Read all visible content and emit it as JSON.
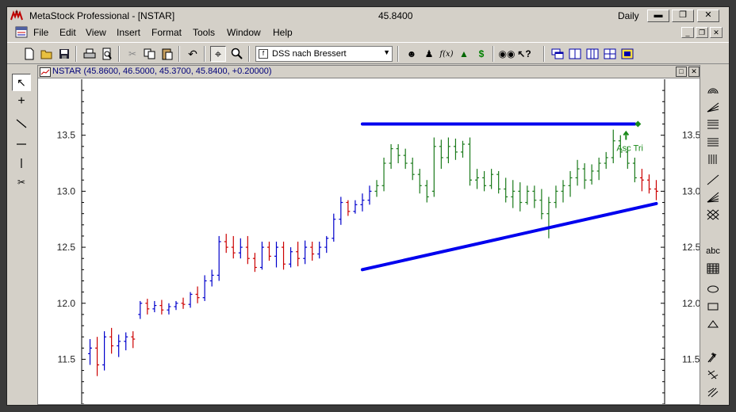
{
  "window": {
    "title": "MetaStock Professional - [NSTAR]",
    "price": "45.8400",
    "period": "Daily",
    "controls": [
      "minimize",
      "restore",
      "close"
    ]
  },
  "menu": {
    "items": [
      "File",
      "Edit",
      "View",
      "Insert",
      "Format",
      "Tools",
      "Window",
      "Help"
    ]
  },
  "toolbar": {
    "expert_combo_value": "DSS nach Bressert",
    "fx_label": "f(x)",
    "dollar_label": "$"
  },
  "chart_window": {
    "caption": "NSTAR (45.8600, 46.5000, 45.3700, 45.8400, +0.20000)"
  },
  "icons": {
    "left_tools": [
      "pointer-icon",
      "crosshair-icon",
      "diagonal-line-icon",
      "horizontal-line-icon",
      "vertical-line-icon",
      "scissors-icon"
    ],
    "right_tools": [
      "arc-icon",
      "fan-icon",
      "fibonacci-retracement-icon",
      "horizontal-lines-icon",
      "vertical-lines-icon",
      "trendline-icon",
      "speed-lines-icon",
      "gann-grid-icon",
      "text-icon",
      "grid-icon",
      "ellipse-icon",
      "rectangle-icon",
      "triangle-icon",
      "buy-arrow-icon",
      "sell-arrow-icon",
      "exit-arrow-icon"
    ]
  },
  "text_tool_label": "abc",
  "chart_data": {
    "type": "ohlc",
    "symbol": "NSTAR",
    "y_ticks": [
      "13.5",
      "13.0",
      "12.5",
      "12.0",
      "11.5"
    ],
    "y_tick_values": [
      13.5,
      13.0,
      12.5,
      12.0,
      11.5
    ],
    "ylim": [
      11.1,
      14.0
    ],
    "colors": {
      "up": "#0000cc",
      "down": "#cc0000",
      "pattern": "#1a7a1a",
      "trendline": "#0000ee",
      "annotation": "#1a8a1a"
    },
    "annotation": {
      "text": "Asc Tri",
      "bar": 75,
      "price": 13.6
    },
    "trendlines": [
      {
        "from": {
          "bar": 38,
          "price": 13.6
        },
        "to": {
          "bar": 76,
          "price": 13.6
        }
      },
      {
        "from": {
          "bar": 38,
          "price": 12.3
        },
        "to": {
          "bar": 79,
          "price": 12.89
        }
      }
    ],
    "pattern_range": [
      40,
      76
    ],
    "bars": [
      {
        "o": 11.55,
        "h": 11.68,
        "l": 11.45,
        "c": 11.6
      },
      {
        "o": 11.6,
        "h": 11.7,
        "l": 11.35,
        "c": 11.45
      },
      {
        "o": 11.45,
        "h": 11.75,
        "l": 11.4,
        "c": 11.7
      },
      {
        "o": 11.7,
        "h": 11.78,
        "l": 11.55,
        "c": 11.62
      },
      {
        "o": 11.62,
        "h": 11.72,
        "l": 11.52,
        "c": 11.66
      },
      {
        "o": 11.66,
        "h": 11.74,
        "l": 11.58,
        "c": 11.7
      },
      {
        "o": 11.7,
        "h": 11.75,
        "l": 11.6,
        "c": 11.68
      },
      {
        "o": 11.9,
        "h": 12.02,
        "l": 11.86,
        "c": 12.0
      },
      {
        "o": 12.0,
        "h": 12.04,
        "l": 11.9,
        "c": 11.95
      },
      {
        "o": 11.95,
        "h": 12.02,
        "l": 11.92,
        "c": 11.98
      },
      {
        "o": 11.98,
        "h": 12.03,
        "l": 11.9,
        "c": 11.94
      },
      {
        "o": 11.94,
        "h": 12.0,
        "l": 11.9,
        "c": 11.97
      },
      {
        "o": 11.97,
        "h": 12.02,
        "l": 11.94,
        "c": 12.0
      },
      {
        "o": 12.0,
        "h": 12.05,
        "l": 11.95,
        "c": 11.99
      },
      {
        "o": 11.99,
        "h": 12.1,
        "l": 11.96,
        "c": 12.08
      },
      {
        "o": 12.08,
        "h": 12.15,
        "l": 12.0,
        "c": 12.05
      },
      {
        "o": 12.05,
        "h": 12.25,
        "l": 12.02,
        "c": 12.2
      },
      {
        "o": 12.2,
        "h": 12.3,
        "l": 12.15,
        "c": 12.25
      },
      {
        "o": 12.25,
        "h": 12.6,
        "l": 12.2,
        "c": 12.55
      },
      {
        "o": 12.55,
        "h": 12.62,
        "l": 12.45,
        "c": 12.5
      },
      {
        "o": 12.5,
        "h": 12.6,
        "l": 12.4,
        "c": 12.45
      },
      {
        "o": 12.45,
        "h": 12.58,
        "l": 12.4,
        "c": 12.5
      },
      {
        "o": 12.5,
        "h": 12.6,
        "l": 12.35,
        "c": 12.4
      },
      {
        "o": 12.4,
        "h": 12.45,
        "l": 12.28,
        "c": 12.32
      },
      {
        "o": 12.32,
        "h": 12.55,
        "l": 12.3,
        "c": 12.5
      },
      {
        "o": 12.5,
        "h": 12.55,
        "l": 12.38,
        "c": 12.42
      },
      {
        "o": 12.42,
        "h": 12.55,
        "l": 12.32,
        "c": 12.5
      },
      {
        "o": 12.5,
        "h": 12.55,
        "l": 12.3,
        "c": 12.35
      },
      {
        "o": 12.35,
        "h": 12.5,
        "l": 12.32,
        "c": 12.46
      },
      {
        "o": 12.46,
        "h": 12.55,
        "l": 12.33,
        "c": 12.4
      },
      {
        "o": 12.4,
        "h": 12.56,
        "l": 12.35,
        "c": 12.5
      },
      {
        "o": 12.5,
        "h": 12.55,
        "l": 12.38,
        "c": 12.44
      },
      {
        "o": 12.44,
        "h": 12.55,
        "l": 12.4,
        "c": 12.5
      },
      {
        "o": 12.5,
        "h": 12.6,
        "l": 12.45,
        "c": 12.58
      },
      {
        "o": 12.58,
        "h": 12.8,
        "l": 12.55,
        "c": 12.75
      },
      {
        "o": 12.75,
        "h": 12.95,
        "l": 12.7,
        "c": 12.9
      },
      {
        "o": 12.9,
        "h": 12.92,
        "l": 12.78,
        "c": 12.82
      },
      {
        "o": 12.82,
        "h": 12.92,
        "l": 12.8,
        "c": 12.88
      },
      {
        "o": 12.88,
        "h": 12.98,
        "l": 12.82,
        "c": 12.92
      },
      {
        "o": 12.92,
        "h": 13.05,
        "l": 12.88,
        "c": 13.0
      },
      {
        "o": 13.0,
        "h": 13.1,
        "l": 12.95,
        "c": 13.05
      },
      {
        "o": 13.05,
        "h": 13.3,
        "l": 13.0,
        "c": 13.25
      },
      {
        "o": 13.25,
        "h": 13.42,
        "l": 13.2,
        "c": 13.38
      },
      {
        "o": 13.38,
        "h": 13.42,
        "l": 13.25,
        "c": 13.32
      },
      {
        "o": 13.32,
        "h": 13.38,
        "l": 13.2,
        "c": 13.25
      },
      {
        "o": 13.25,
        "h": 13.3,
        "l": 13.1,
        "c": 13.15
      },
      {
        "o": 13.15,
        "h": 13.2,
        "l": 12.98,
        "c": 13.05
      },
      {
        "o": 13.05,
        "h": 13.1,
        "l": 12.9,
        "c": 12.95
      },
      {
        "o": 13.0,
        "h": 13.48,
        "l": 12.95,
        "c": 13.4
      },
      {
        "o": 13.4,
        "h": 13.46,
        "l": 13.2,
        "c": 13.3
      },
      {
        "o": 13.3,
        "h": 13.48,
        "l": 13.25,
        "c": 13.4
      },
      {
        "o": 13.4,
        "h": 13.47,
        "l": 13.28,
        "c": 13.35
      },
      {
        "o": 13.35,
        "h": 13.45,
        "l": 13.3,
        "c": 13.42
      },
      {
        "o": 13.42,
        "h": 13.48,
        "l": 13.05,
        "c": 13.1
      },
      {
        "o": 13.1,
        "h": 13.2,
        "l": 13.02,
        "c": 13.12
      },
      {
        "o": 13.12,
        "h": 13.18,
        "l": 13.0,
        "c": 13.05
      },
      {
        "o": 13.05,
        "h": 13.2,
        "l": 13.02,
        "c": 13.15
      },
      {
        "o": 13.15,
        "h": 13.18,
        "l": 12.98,
        "c": 13.02
      },
      {
        "o": 13.02,
        "h": 13.12,
        "l": 12.9,
        "c": 12.95
      },
      {
        "o": 12.95,
        "h": 13.1,
        "l": 12.85,
        "c": 13.0
      },
      {
        "o": 13.0,
        "h": 13.08,
        "l": 12.82,
        "c": 12.9
      },
      {
        "o": 12.9,
        "h": 13.05,
        "l": 12.88,
        "c": 13.0
      },
      {
        "o": 13.0,
        "h": 13.05,
        "l": 12.85,
        "c": 12.92
      },
      {
        "o": 12.92,
        "h": 13.02,
        "l": 12.75,
        "c": 12.8
      },
      {
        "o": 12.8,
        "h": 12.95,
        "l": 12.58,
        "c": 12.9
      },
      {
        "o": 12.9,
        "h": 13.05,
        "l": 12.85,
        "c": 13.0
      },
      {
        "o": 13.0,
        "h": 13.1,
        "l": 12.9,
        "c": 13.05
      },
      {
        "o": 13.05,
        "h": 13.18,
        "l": 12.95,
        "c": 13.12
      },
      {
        "o": 13.12,
        "h": 13.28,
        "l": 13.05,
        "c": 13.2
      },
      {
        "o": 13.2,
        "h": 13.25,
        "l": 13.02,
        "c": 13.1
      },
      {
        "o": 13.1,
        "h": 13.24,
        "l": 13.06,
        "c": 13.18
      },
      {
        "o": 13.18,
        "h": 13.3,
        "l": 13.1,
        "c": 13.25
      },
      {
        "o": 13.25,
        "h": 13.35,
        "l": 13.2,
        "c": 13.3
      },
      {
        "o": 13.3,
        "h": 13.55,
        "l": 13.25,
        "c": 13.45
      },
      {
        "o": 13.45,
        "h": 13.5,
        "l": 13.3,
        "c": 13.35
      },
      {
        "o": 13.35,
        "h": 13.4,
        "l": 13.2,
        "c": 13.25
      },
      {
        "o": 13.25,
        "h": 13.3,
        "l": 13.08,
        "c": 13.12
      },
      {
        "o": 13.12,
        "h": 13.2,
        "l": 13.0,
        "c": 13.1
      },
      {
        "o": 13.1,
        "h": 13.15,
        "l": 12.98,
        "c": 13.02
      },
      {
        "o": 13.02,
        "h": 13.1,
        "l": 12.92,
        "c": 13.0
      }
    ]
  }
}
